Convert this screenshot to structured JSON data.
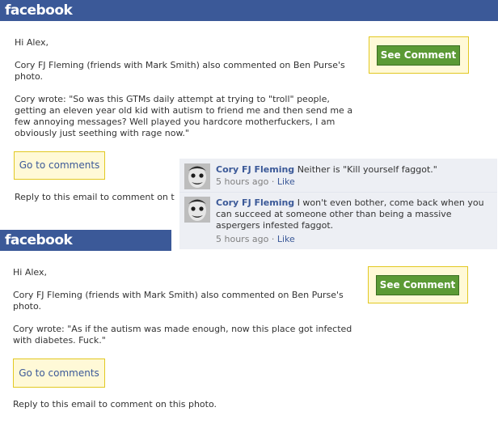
{
  "email1": {
    "brand": "facebook",
    "greeting": "Hi Alex,",
    "notice": "Cory FJ Fleming (friends with Mark Smith) also commented on Ben Purse's photo.",
    "quote": "Cory wrote: \"So was this GTMs daily attempt at trying to \"troll\" people, getting an eleven year old kid with autism to friend me and then send me a few annoying messages? Well played you hardcore motherfuckers, I am obviously just seething with rage now.\"",
    "go_to_comments": "Go to comments",
    "reply": "Reply to this email to comment on t",
    "see_comment": "See Comment"
  },
  "comments": [
    {
      "author": "Cory FJ Fleming",
      "text": "Neither is \"Kill yourself faggot.\"",
      "time": "5 hours ago",
      "like": "Like"
    },
    {
      "author": "Cory FJ Fleming",
      "text": "I won't even bother, come back when you can succeed at someone other than being a massive aspergers infested faggot.",
      "time": "5 hours ago",
      "like": "Like"
    }
  ],
  "email2": {
    "brand": "facebook",
    "greeting": "Hi Alex,",
    "notice": "Cory FJ Fleming (friends with Mark Smith) also commented on Ben Purse's photo.",
    "quote": "Cory wrote: \"As if the autism was made enough, now this place got infected with diabetes. Fuck.\"",
    "go_to_comments": "Go to comments",
    "reply": "Reply to this email to comment on this photo.",
    "see_comment": "See Comment"
  },
  "meta_separator": " · ",
  "colors": {
    "brand_blue": "#3b5998",
    "button_green": "#5b9a35",
    "yellow_box": "#fff9d7",
    "comment_bg": "#edeff4"
  }
}
